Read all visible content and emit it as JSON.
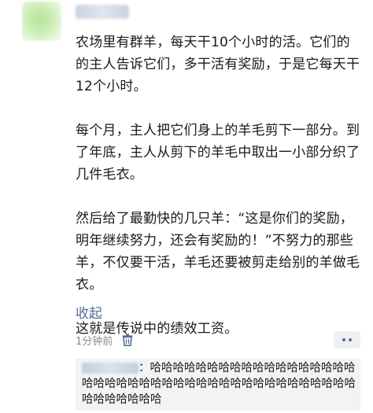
{
  "post": {
    "paragraphs": [
      "农场里有群羊，每天干10个小时的活。它们的的主人告诉它们，多干活有奖励，于是它每天干12个小时。",
      "每个月，主人把它们身上的羊毛剪下一部分。到了年底，主人从剪下的羊毛中取出一小部分织了几件毛衣。",
      "然后给了最勤快的几只羊：“这是你们的奖励，明年继续努力，还会有奖励的！”不努力的那些羊，不仅要干活，羊毛还要被剪走给别的羊做毛衣。",
      "这就是传说中的绩效工资。"
    ],
    "collapse_label": "收起",
    "time": "1分钟前"
  },
  "comment": {
    "separator": "：",
    "text": "哈哈哈哈哈哈哈哈哈哈哈哈哈哈哈哈哈哈哈哈哈哈哈哈哈哈哈哈哈哈哈哈哈哈哈哈哈哈哈哈哈哈哈哈哈哈哈哈哈"
  },
  "icons": {
    "delete": "trash-icon",
    "more": "more-dots-icon"
  },
  "colors": {
    "link": "#576b95",
    "meta_text": "#8a8a8a",
    "comment_bg": "#f3f3f5"
  }
}
